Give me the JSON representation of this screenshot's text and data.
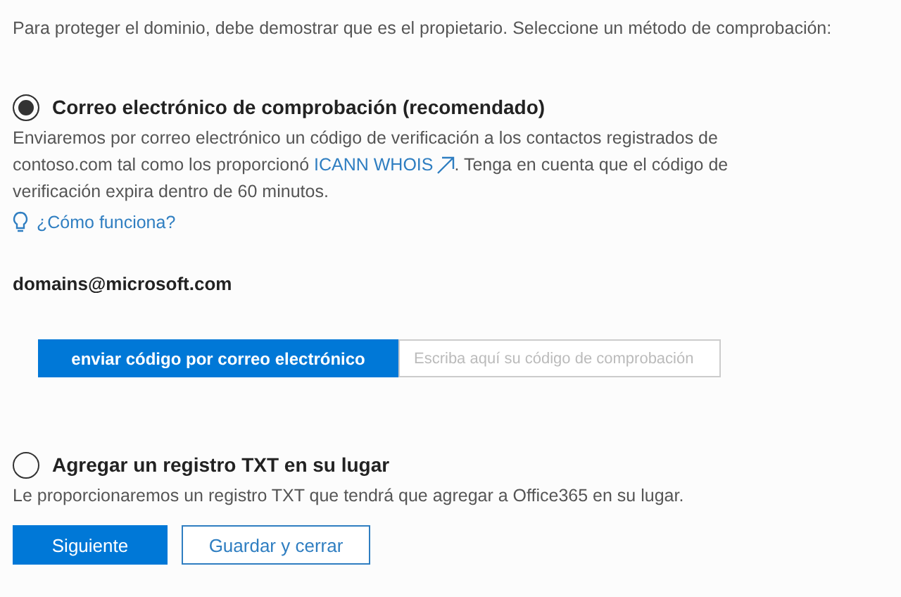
{
  "intro": "Para proteger el dominio, debe demostrar que es el propietario. Seleccione un método de comprobación:",
  "options": [
    {
      "kind": "email",
      "label": "Correo electrónico de comprobación (recomendado)",
      "selected": true,
      "description_before": "Enviaremos por correo electrónico un código de verificación a los contactos registrados de contoso.com tal como los proporcionó",
      "link": "ICANN WHOIS",
      "description_after": ". Tenga en cuenta que el código de verificación expira dentro de 60 minutos.",
      "help_link": "¿Cómo funciona?",
      "email": "domains@microsoft.com",
      "send_button": "enviar código por correo electrónico",
      "code_placeholder": "Escriba aquí su código de comprobación"
    },
    {
      "kind": "txt",
      "label": "Agregar un registro TXT en su lugar",
      "selected": false,
      "description": "Le proporcionaremos un registro TXT que tendrá que agregar a Office365 en su lugar."
    }
  ],
  "buttons": [
    {
      "label": "Siguiente",
      "primary": true
    },
    {
      "label": "Guardar y cerrar",
      "primary": false
    }
  ]
}
